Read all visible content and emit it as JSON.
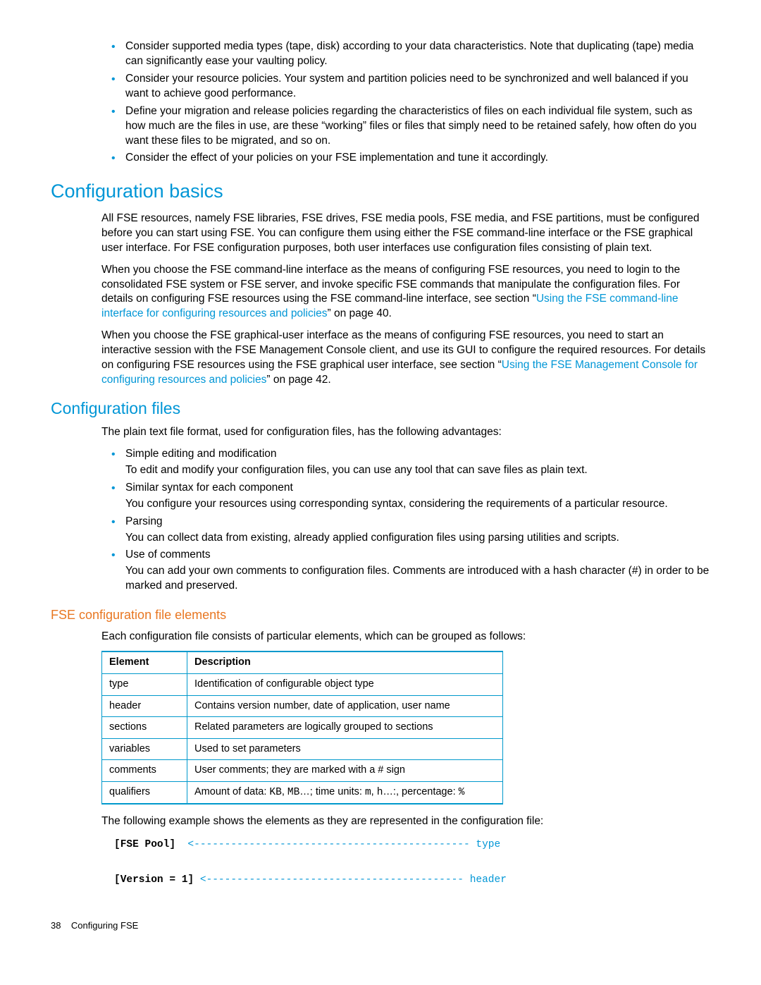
{
  "top_bullets": [
    "Consider supported media types (tape, disk) according to your data characteristics. Note that duplicating (tape) media can significantly ease your vaulting policy.",
    "Consider your resource policies. Your system and partition policies need to be synchronized and well balanced if you want to achieve good performance.",
    "Define your migration and release policies regarding the characteristics of files on each individual file system, such as how much are the files in use, are these “working” files or files that simply need to be retained safely, how often do you want these files to be migrated, and so on.",
    "Consider the effect of your policies on your FSE implementation and tune it accordingly."
  ],
  "h1a": "Configuration basics",
  "p1": "All FSE resources, namely FSE libraries, FSE drives, FSE media pools, FSE media, and FSE partitions, must be configured before you can start using FSE. You can configure them using either the FSE command-line interface or the FSE graphical user interface. For FSE configuration purposes, both user interfaces use configuration files consisting of plain text.",
  "p2_pre": "When you choose the FSE command-line interface as the means of configuring FSE resources, you need to login to the consolidated FSE system or FSE server, and invoke specific FSE commands that manipulate the configuration files. For details on configuring FSE resources using the FSE command-line interface, see section “",
  "p2_link": "Using the FSE command-line interface for configuring resources and policies",
  "p2_post": "” on page 40.",
  "p3_pre": "When you choose the FSE graphical-user interface as the means of configuring FSE resources, you need to start an interactive session with the FSE Management Console client, and use its GUI to configure the required resources. For details on configuring FSE resources using the FSE graphical user interface, see section “",
  "p3_link": "Using the FSE Management Console for configuring resources and policies",
  "p3_post": "” on page 42.",
  "h2a": "Configuration files",
  "p4": "The plain text file format, used for configuration files, has the following advantages:",
  "adv": [
    {
      "title": "Simple editing and modification",
      "body": "To edit and modify your configuration files, you can use any tool that can save files as plain text."
    },
    {
      "title": "Similar syntax for each component",
      "body": "You configure your resources using corresponding syntax, considering the requirements of a particular resource."
    },
    {
      "title": "Parsing",
      "body": "You can collect data from existing, already applied configuration files using parsing utilities and scripts."
    },
    {
      "title": "Use of comments",
      "body": "You can add your own comments to configuration files. Comments are introduced with a hash character (#) in order to be marked and preserved."
    }
  ],
  "h3a": "FSE configuration file elements",
  "p5": "Each configuration file consists of particular elements, which can be grouped as follows:",
  "table": {
    "head": [
      "Element",
      "Description"
    ],
    "rows": [
      [
        "type",
        "Identification of configurable object type"
      ],
      [
        "header",
        "Contains version number, date of application, user name"
      ],
      [
        "sections",
        "Related parameters are logically grouped to sections"
      ],
      [
        "variables",
        "Used to set parameters"
      ],
      [
        "comments",
        "User comments; they are marked with a # sign"
      ],
      [
        "qualifiers",
        "__QUAL__"
      ]
    ],
    "qual_pre": "Amount of data: ",
    "qual_c1": "KB",
    "qual_mid1": ", ",
    "qual_c2": "MB",
    "qual_mid2": "…; time units: ",
    "qual_c3": "m",
    "qual_mid3": ", ",
    "qual_c4": "h",
    "qual_mid4": "…:, percentage: ",
    "qual_c5": "%"
  },
  "p6": "The following example shows the elements as they are represented in the configuration file:",
  "code": {
    "l1a": "[FSE Pool]",
    "l1b": "  <--------------------------------------------- type",
    "l2a": "[Version = 1]",
    "l2b": " <------------------------------------------ header"
  },
  "footer_page": "38",
  "footer_label": "Configuring FSE"
}
